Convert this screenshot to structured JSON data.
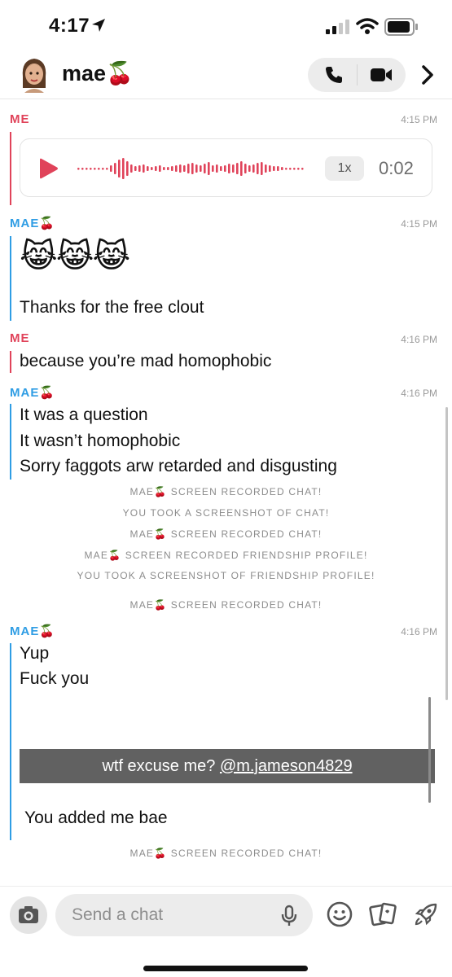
{
  "status_bar": {
    "time": "4:17"
  },
  "header": {
    "contact_name": "mae🍒"
  },
  "messages": [
    {
      "sender": "ME",
      "time": "4:15 PM"
    },
    {
      "sender": "MAE🍒",
      "time": "4:15 PM",
      "emojis": "😹😹😹",
      "lines": [
        "Thanks for the free clout"
      ]
    },
    {
      "sender": "ME",
      "time": "4:16 PM",
      "lines": [
        "because you’re mad homophobic"
      ]
    },
    {
      "sender": "MAE🍒",
      "time": "4:16 PM",
      "lines": [
        "It was a question",
        "It wasn’t homophobic",
        "Sorry faggots arw retarded and disgusting"
      ]
    },
    {
      "sender": "MAE🍒",
      "time": "4:16 PM",
      "lines": [
        "Yup",
        "Fuck you",
        "You added me bae"
      ]
    }
  ],
  "voice_note": {
    "speed": "1x",
    "duration": "0:02"
  },
  "system_notes": [
    "MAE🍒 SCREEN RECORDED CHAT!",
    "YOU TOOK A SCREENSHOT OF CHAT!",
    "MAE🍒 SCREEN RECORDED CHAT!",
    "MAE🍒 SCREEN RECORDED FRIENDSHIP PROFILE!",
    "YOU TOOK A SCREENSHOT OF FRIENDSHIP PROFILE!",
    "MAE🍒 SCREEN RECORDED CHAT!",
    "MAE🍒 SCREEN RECORDED CHAT!"
  ],
  "caption_overlay": {
    "text": "wtf excuse me? ",
    "mention": "@m.jameson4829"
  },
  "composer": {
    "placeholder": "Send a chat"
  },
  "colors": {
    "me": "#e0435a",
    "mae": "#2f9de4"
  },
  "icons": [
    "location-arrow-icon",
    "signal-icon",
    "wifi-icon",
    "battery-icon",
    "phone-icon",
    "video-camera-icon",
    "chevron-right-icon",
    "play-icon",
    "camera-icon",
    "microphone-icon",
    "smiley-icon",
    "cards-icon",
    "rocket-icon"
  ]
}
